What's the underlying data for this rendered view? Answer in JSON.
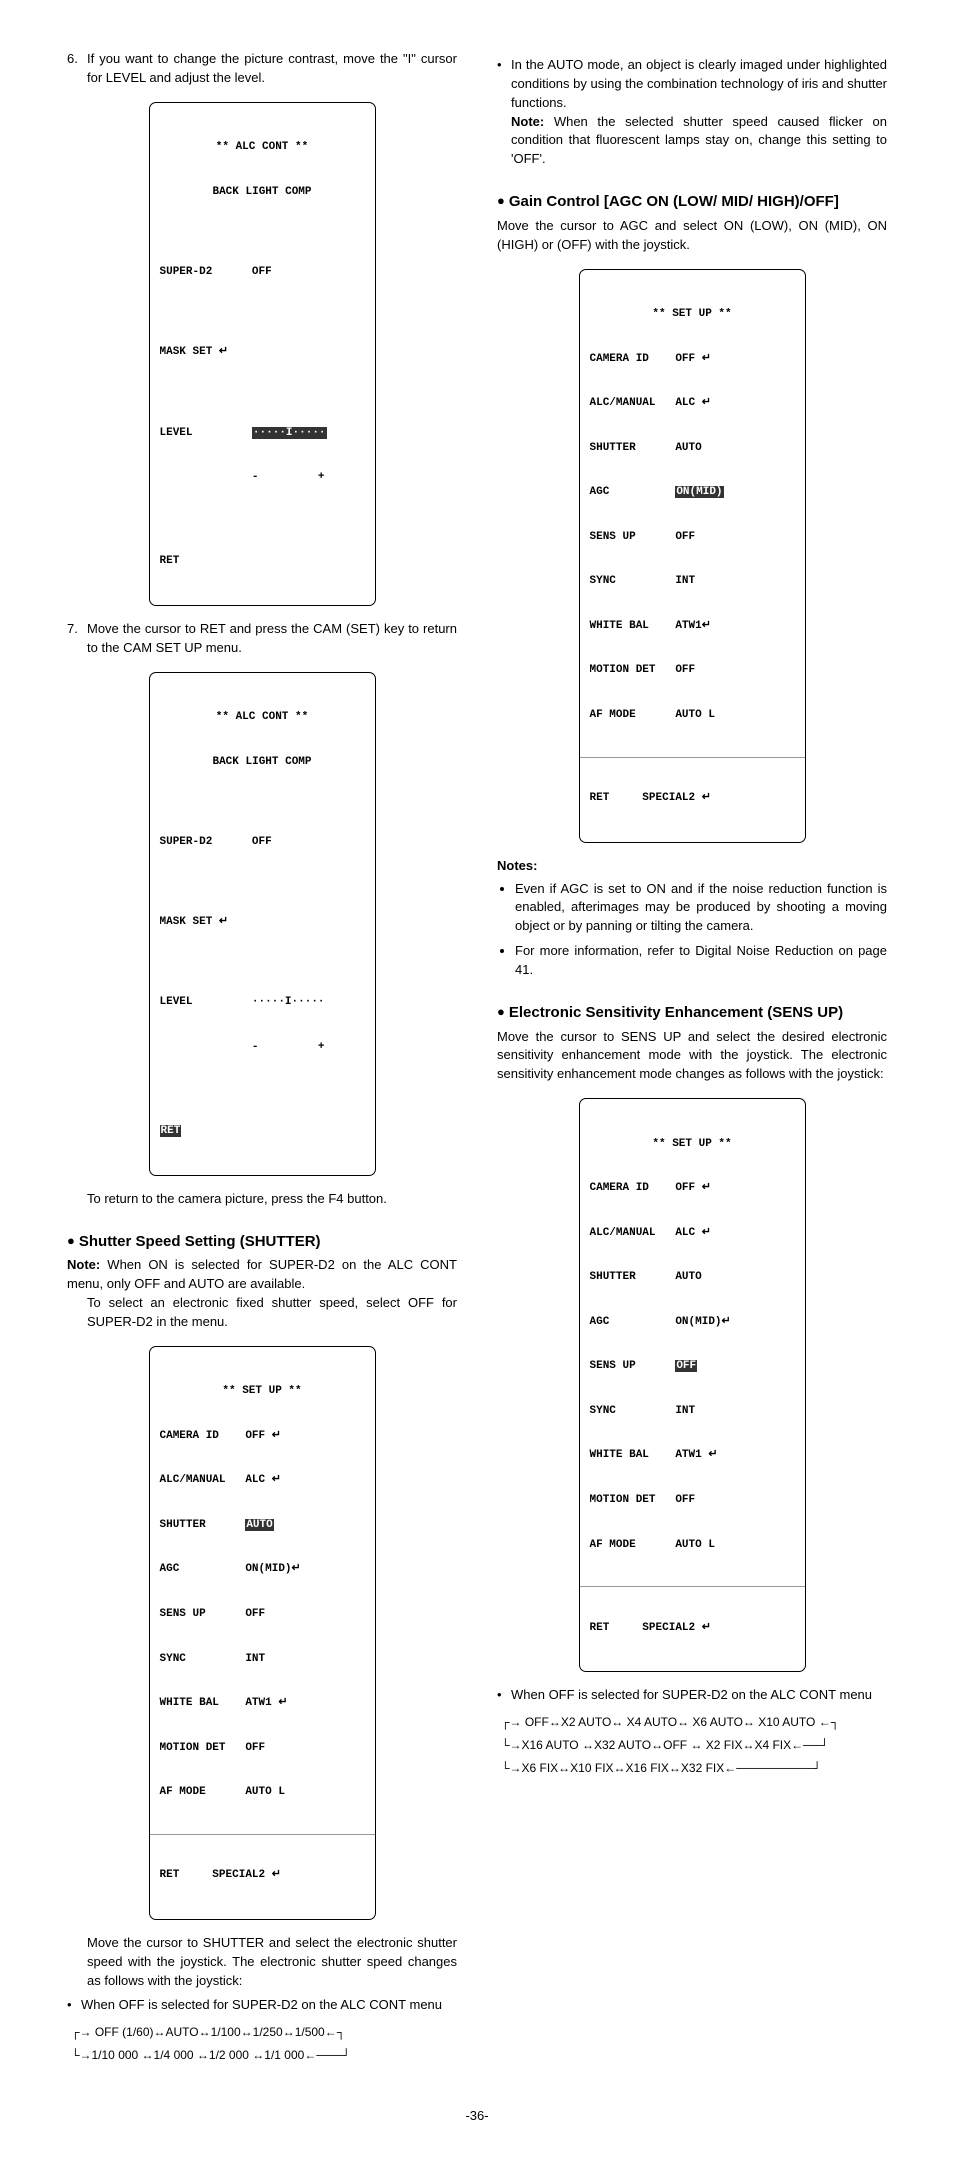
{
  "left": {
    "step6": "If you want to change the picture contrast, move the \"I\" cursor for LEVEL and adjust the level.",
    "menu1": {
      "t1": "** ALC CONT **",
      "t2": "BACK LIGHT COMP",
      "r1": "SUPER-D2      OFF",
      "r2": "MASK SET ↵",
      "r3a": "LEVEL         ",
      "r3b": "·····I·····",
      "r3c": "              -         +",
      "r4": "RET"
    },
    "step7": "Move the cursor to RET and press the CAM (SET) key to return to the CAM SET UP menu.",
    "menu2": {
      "t1": "** ALC CONT **",
      "t2": "BACK LIGHT COMP",
      "r1": "SUPER-D2      OFF",
      "r2": "MASK SET ↵",
      "r3": "LEVEL         ·····I·····",
      "r3b": "              -         +",
      "r4": "RET"
    },
    "return_text": "To return to the camera picture, press the F4 button.",
    "shutter_h": "Shutter Speed Setting (SHUTTER)",
    "shutter_note": "When ON is selected for SUPER-D2 on the ALC CONT menu, only OFF and AUTO are available.",
    "shutter_note2": "To select an electronic fixed shutter speed, select OFF for SUPER-D2 in the menu.",
    "menu3": {
      "t": "** SET UP **",
      "r": [
        "CAMERA ID    OFF ↵",
        "ALC/MANUAL   ALC ↵",
        "SHUTTER      |AUTO|",
        "AGC          ON(MID)↵",
        "SENS UP      OFF",
        "SYNC         INT",
        "WHITE BAL    ATW1 ↵",
        "MOTION DET   OFF",
        "AF MODE      AUTO L"
      ],
      "f": "RET     SPECIAL2 ↵"
    },
    "shutter_move": "Move the cursor to SHUTTER and select the electronic shutter speed with the joystick. The electronic shutter speed changes as follows with the joystick:",
    "shutter_off": "When OFF is selected for SUPER-D2 on the ALC CONT menu",
    "flow1a": "┌→ OFF (1/60)↔AUTO↔1/100↔1/250↔1/500←┐",
    "flow1b": "└→1/10 000 ↔1/4 000 ↔1/2 000 ↔1/1 000←───┘"
  },
  "right": {
    "auto_bullet": "In the AUTO mode, an object is clearly imaged under highlighted conditions by using the combination technology of iris and shutter functions.",
    "auto_note": "When the selected shutter speed caused flicker on condition that fluorescent lamps stay on, change this setting to 'OFF'.",
    "gain_h": "Gain Control [AGC ON (LOW/ MID/ HIGH)/OFF]",
    "gain_p": "Move the cursor to AGC and select ON (LOW), ON (MID), ON (HIGH) or (OFF) with the joystick.",
    "menu4": {
      "t": "** SET UP **",
      "r": [
        "CAMERA ID    OFF ↵",
        "ALC/MANUAL   ALC ↵",
        "SHUTTER      AUTO",
        "AGC          |ON(MID)|",
        "SENS UP      OFF",
        "SYNC         INT",
        "WHITE BAL    ATW1↵",
        "MOTION DET   OFF",
        "AF MODE      AUTO L"
      ],
      "f": "RET     SPECIAL2 ↵"
    },
    "notes_h": "Notes:",
    "notes": [
      "Even if AGC is set to ON and if the noise reduction function is enabled, afterimages may be produced by shooting a moving object or by panning or tilting the camera.",
      "For more information, refer to Digital Noise Reduction on page 41."
    ],
    "sens_h": "Electronic Sensitivity Enhancement (SENS UP)",
    "sens_p": "Move the cursor to SENS UP and select the desired electronic sensitivity enhancement mode with the joystick. The electronic sensitivity enhancement mode changes as follows with the joystick:",
    "menu5": {
      "t": "** SET UP **",
      "r": [
        "CAMERA ID    OFF ↵",
        "ALC/MANUAL   ALC ↵",
        "SHUTTER      AUTO",
        "AGC          ON(MID)↵",
        "SENS UP      |OFF|",
        "SYNC         INT",
        "WHITE BAL    ATW1 ↵",
        "MOTION DET   OFF",
        "AF MODE      AUTO L"
      ],
      "f": "RET     SPECIAL2 ↵"
    },
    "sens_off": "When OFF is selected for SUPER-D2 on the ALC CONT menu",
    "flow2a": "┌→ OFF↔X2 AUTO↔ X4 AUTO↔ X6 AUTO↔ X10 AUTO ←┐",
    "flow2b": "└→X16 AUTO ↔X32 AUTO↔OFF ↔ X2 FIX↔X4 FIX←──┘",
    "flow2c": "└→X6 FIX↔X10 FIX↔X16 FIX↔X32 FIX←─────────┘"
  },
  "pagenum": "-36-"
}
